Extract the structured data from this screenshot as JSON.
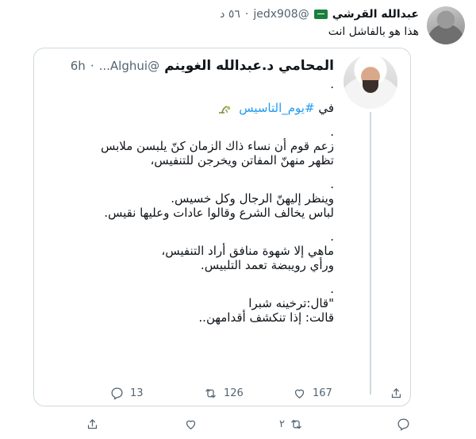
{
  "reply": {
    "name": "عبدالله القرشي",
    "handle": "@jedx908",
    "dot": "·",
    "time": "٥٦ د",
    "text": "هذا هو بالفاشل انت",
    "actions": {
      "retweets": "٢"
    }
  },
  "quoted": {
    "name": "المحامي د.عبدالله الغوينم",
    "handle": "@Alghui...",
    "dot": "·",
    "time": "6h",
    "lines": [
      ".",
      "في #يوم_التاسيس",
      ".",
      "زعم قوم أن نساء ذاك الزمان كنّ يلبسن ملابس",
      "تظهر منهنّ المفاتن ويخرجن للتنفيس،",
      ".",
      "وينظر إليهنّ الرجال وكل خسيس.",
      "لباس يخالف الشرع وقالوا عادات وعليها نقيس.",
      ".",
      "ماهي إلا شهوة منافق أراد التنفيس،",
      "ورأي رويبضة تعمد التلبيس.",
      ".",
      "\"قال:ترخينه شبرا",
      "قالت: إذا تنكشف أقدامهن.."
    ],
    "hashtag": "#يوم_التاسيس",
    "actions": {
      "replies": "13",
      "retweets": "126",
      "likes": "167"
    }
  },
  "colors": {
    "accent": "#1d9bf0",
    "muted": "#536471",
    "border": "#cfd9de",
    "flag": "#1a7f3c"
  }
}
